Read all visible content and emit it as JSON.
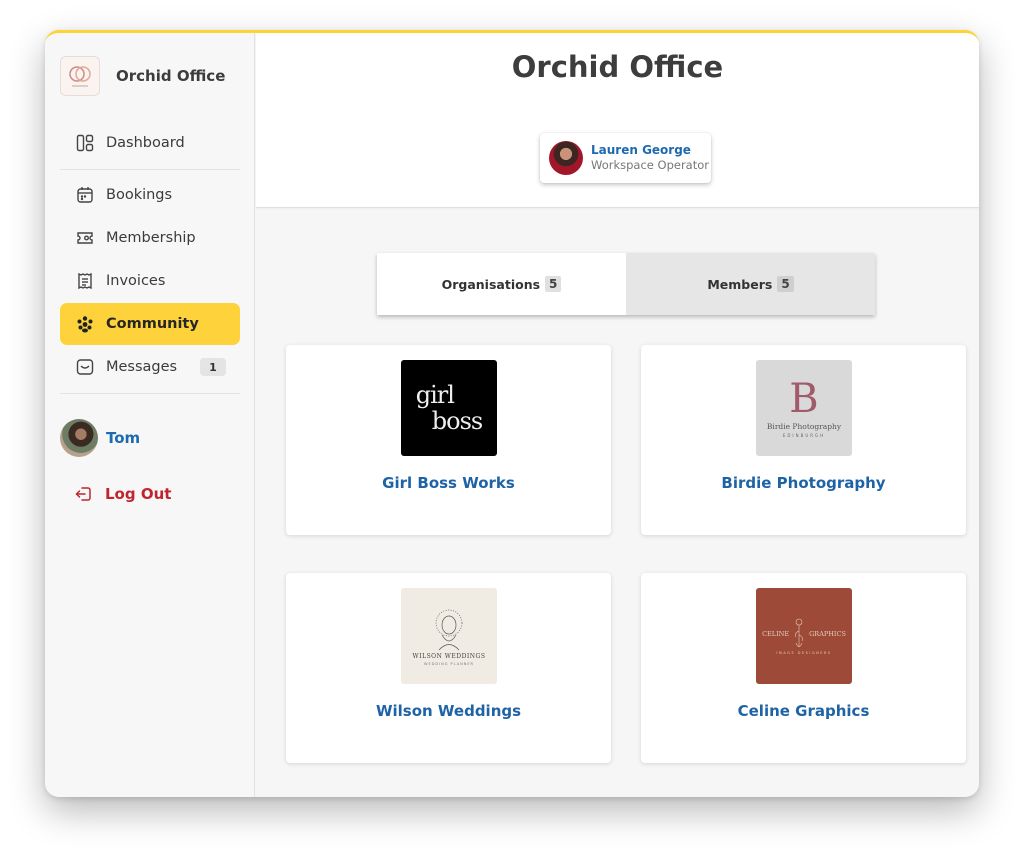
{
  "app": {
    "name": "Orchid Office",
    "accent_color": "#fdd23a",
    "link_color": "#1e6ab0",
    "danger_color": "#c0252f"
  },
  "sidebar": {
    "brand_name": "Orchid Office",
    "items": [
      {
        "id": "dashboard",
        "label": "Dashboard",
        "icon": "dashboard-icon",
        "active": false
      },
      {
        "id": "bookings",
        "label": "Bookings",
        "icon": "calendar-icon",
        "active": false
      },
      {
        "id": "membership",
        "label": "Membership",
        "icon": "ticket-icon",
        "active": false
      },
      {
        "id": "invoices",
        "label": "Invoices",
        "icon": "receipt-icon",
        "active": false
      },
      {
        "id": "community",
        "label": "Community",
        "icon": "people-icon",
        "active": true
      },
      {
        "id": "messages",
        "label": "Messages",
        "icon": "inbox-icon",
        "active": false,
        "badge": "1"
      }
    ],
    "user": {
      "name": "Tom"
    },
    "logout_label": "Log Out"
  },
  "header": {
    "title": "Orchid Office",
    "operator": {
      "name": "Lauren George",
      "role": "Workspace Operator"
    }
  },
  "tabs": [
    {
      "label": "Organisations",
      "count": "5",
      "active": true
    },
    {
      "label": "Members",
      "count": "5",
      "active": false
    }
  ],
  "organisations": [
    {
      "name": "Girl Boss Works",
      "logo_text": [
        "girl",
        "boss"
      ],
      "logo_bg": "#000000"
    },
    {
      "name": "Birdie Photography",
      "logo_text": [
        "B",
        "Birdie Photography",
        "EDINBURGH"
      ],
      "logo_bg": "#d9d9d9"
    },
    {
      "name": "Wilson Weddings",
      "logo_text": [
        "WILSON WEDDINGS",
        "WEDDING PLANNER"
      ],
      "logo_bg": "#f1ece3"
    },
    {
      "name": "Celine Graphics",
      "logo_text": [
        "CELINE",
        "GRAPHICS",
        "IMAGE DESIGNERS"
      ],
      "logo_bg": "#9e4a38"
    }
  ]
}
